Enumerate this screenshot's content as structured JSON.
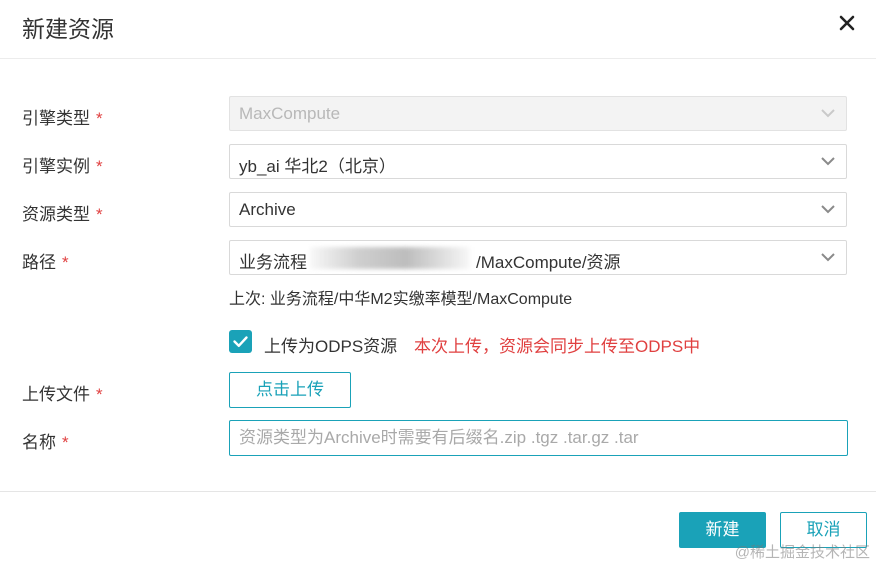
{
  "dialog": {
    "title": "新建资源",
    "close_icon": "close-icon"
  },
  "form": {
    "required_mark": "*",
    "engine_type": {
      "label": "引擎类型",
      "value": "MaxCompute",
      "disabled": true
    },
    "engine_instance": {
      "label": "引擎实例",
      "value": "yb_ai 华北2（北京）"
    },
    "resource_type": {
      "label": "资源类型",
      "value": "Archive"
    },
    "path": {
      "label": "路径",
      "value_prefix": "业务流程",
      "value_suffix": "/MaxCompute/资源",
      "last_hint": "上次: 业务流程/中华M2实缴率模型/MaxCompute"
    },
    "upload_odps": {
      "checked": true,
      "label": "上传为ODPS资源",
      "note": "本次上传，资源会同步上传至ODPS中"
    },
    "upload_file": {
      "label": "上传文件",
      "button": "点击上传"
    },
    "name": {
      "label": "名称",
      "value": "",
      "placeholder": "资源类型为Archive时需要有后缀名.zip .tgz .tar.gz .tar"
    }
  },
  "footer": {
    "create_button": "新建",
    "cancel_button": "取消"
  },
  "watermark": "@稀土掘金技术社区",
  "colors": {
    "accent": "#1aa2b8",
    "required": "#e04040"
  }
}
